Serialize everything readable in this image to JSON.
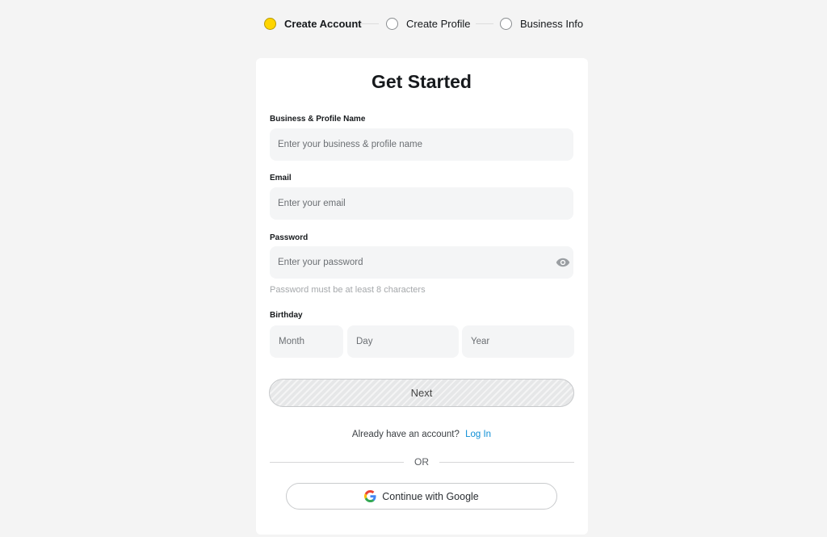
{
  "stepper": {
    "steps": [
      {
        "label": "Create Account",
        "active": true
      },
      {
        "label": "Create Profile",
        "active": false
      },
      {
        "label": "Business Info",
        "active": false
      }
    ]
  },
  "form": {
    "title": "Get Started",
    "business_name": {
      "label": "Business & Profile Name",
      "placeholder": "Enter your business & profile name"
    },
    "email": {
      "label": "Email",
      "placeholder": "Enter your email"
    },
    "password": {
      "label": "Password",
      "placeholder": "Enter your password",
      "hint": "Password must be at least 8 characters"
    },
    "birthday": {
      "label": "Birthday",
      "month_placeholder": "Month",
      "day_placeholder": "Day",
      "year_placeholder": "Year"
    },
    "next_label": "Next",
    "login_prompt": "Already have an account?",
    "login_link": "Log In",
    "or_label": "OR",
    "google_label": "Continue with Google"
  },
  "colors": {
    "active_step": "#ffd500",
    "link": "#0f8fd6",
    "background": "#f4f4f4",
    "card": "#ffffff"
  }
}
